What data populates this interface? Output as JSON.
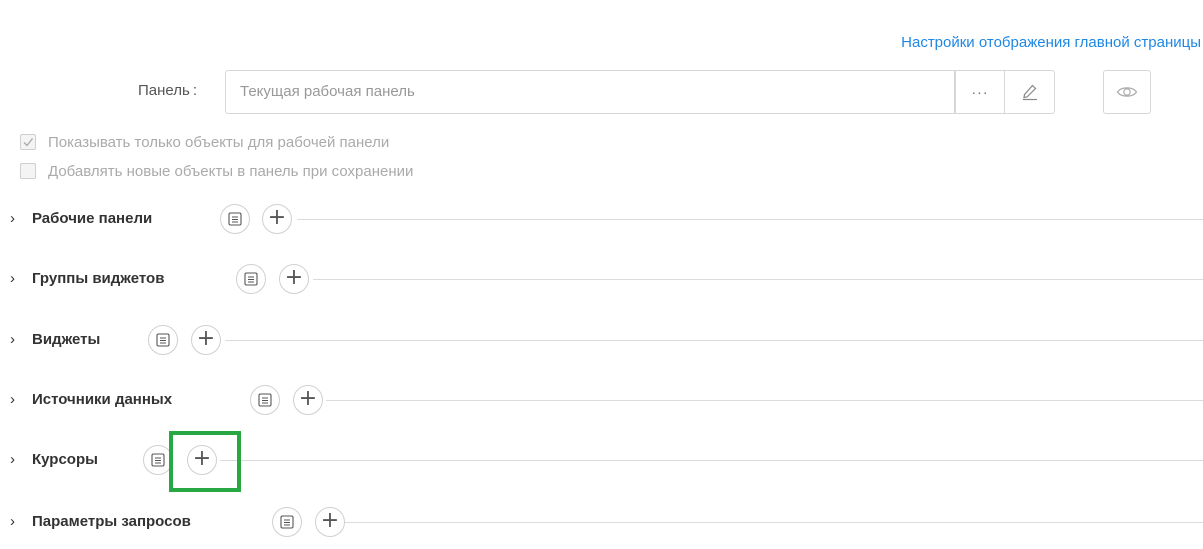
{
  "header": {
    "display_settings_link": "Настройки отображения главной страницы"
  },
  "panel": {
    "label": "Панель",
    "colon": ":",
    "placeholder": "Текущая рабочая панель",
    "more_label": "···"
  },
  "checkboxes": [
    {
      "label": "Показывать только объекты для рабочей панели",
      "checked": true
    },
    {
      "label": "Добавлять новые объекты в панель при сохранении",
      "checked": false
    }
  ],
  "sections": [
    {
      "title": "Рабочие панели"
    },
    {
      "title": "Группы виджетов"
    },
    {
      "title": "Виджеты"
    },
    {
      "title": "Источники данных"
    },
    {
      "title": "Курсоры"
    },
    {
      "title": "Параметры запросов"
    }
  ],
  "chevron": "›",
  "plus": "+",
  "colors": {
    "link": "#1e88e5",
    "highlight": "#28a745"
  }
}
